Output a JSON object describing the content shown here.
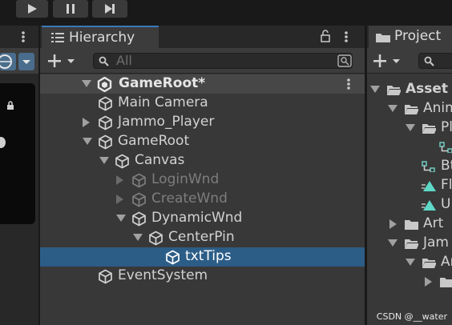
{
  "toolbar": {
    "play_icon": "play-icon",
    "pause_icon": "pause-icon",
    "step_icon": "step-icon"
  },
  "hierarchy": {
    "tab_title": "Hierarchy",
    "search_placeholder": "All",
    "scene_name": "GameRoot*",
    "items": [
      {
        "label": "Main Camera",
        "state": "normal"
      },
      {
        "label": "Jammo_Player",
        "state": "normal"
      },
      {
        "label": "GameRoot",
        "state": "normal"
      },
      {
        "label": "Canvas",
        "state": "normal"
      },
      {
        "label": "LoginWnd",
        "state": "inactive"
      },
      {
        "label": "CreateWnd",
        "state": "inactive"
      },
      {
        "label": "DynamicWnd",
        "state": "normal"
      },
      {
        "label": "CenterPin",
        "state": "normal"
      },
      {
        "label": "txtTips",
        "state": "selected"
      },
      {
        "label": "EventSystem",
        "state": "normal"
      }
    ]
  },
  "project": {
    "tab_title": "Project",
    "items": [
      {
        "label": "Asset"
      },
      {
        "label": "Anim"
      },
      {
        "label": "Pl"
      },
      {
        "label": ""
      },
      {
        "label": "Bt"
      },
      {
        "label": "Fl"
      },
      {
        "label": "U"
      },
      {
        "label": "Art"
      },
      {
        "label": "Jam"
      },
      {
        "label": "Ar"
      },
      {
        "label": ""
      }
    ]
  },
  "watermark": "CSDN @__water",
  "colors": {
    "selected": "#2c5d87",
    "accent": "#3a79bb",
    "text": "#d2d2d2",
    "inactive": "#7d7d7d"
  }
}
